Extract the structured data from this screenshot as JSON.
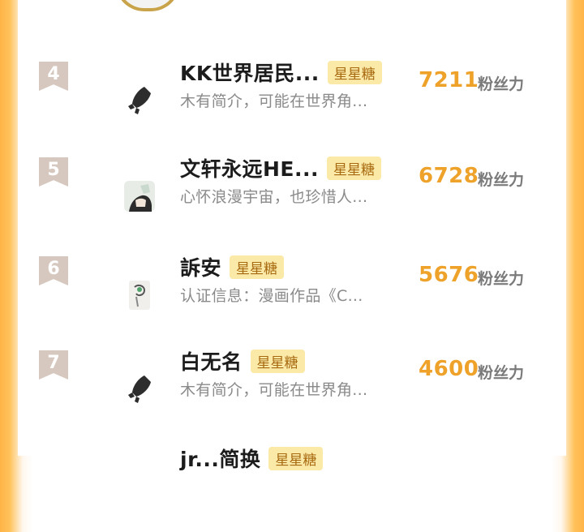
{
  "ranking": {
    "score_unit": "粉丝力",
    "entries": [
      {
        "rank": "4",
        "name": "KK世界居民...",
        "tag": "星星糖",
        "desc": "木有简介，可能在世界角...",
        "score": "7211",
        "avatar": "rocket-avatar"
      },
      {
        "rank": "5",
        "name": "文轩永远HE...",
        "tag": "星星糖",
        "desc": "心怀浪漫宇宙，也珍惜人...",
        "score": "6728",
        "avatar": "anime-avatar"
      },
      {
        "rank": "6",
        "name": "訴安",
        "tag": "星星糖",
        "desc": "认证信息：漫画作品《C...",
        "score": "5676",
        "avatar": "sketch-avatar"
      },
      {
        "rank": "7",
        "name": "白无名",
        "tag": "星星糖",
        "desc": "木有简介，可能在世界角...",
        "score": "4600",
        "avatar": "rocket-avatar"
      },
      {
        "rank": "",
        "name": "jr...简换",
        "tag": "星星糖",
        "desc": "",
        "score": "",
        "avatar": ""
      }
    ]
  },
  "colors": {
    "side_gradient": "#ffb347",
    "score": "#eea22a",
    "tag_bg": "#fbe9a8",
    "tag_text": "#a86a10",
    "rank_badge": "#d6c8bf"
  }
}
